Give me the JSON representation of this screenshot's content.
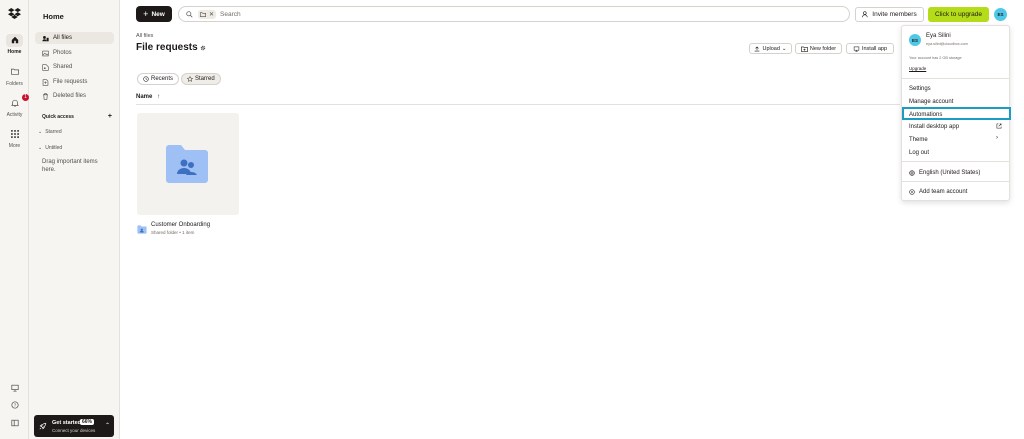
{
  "rail": {
    "items": [
      {
        "label": "Home"
      },
      {
        "label": "Folders"
      },
      {
        "label": "Activity",
        "badge": "1"
      },
      {
        "label": "More"
      }
    ]
  },
  "sidebar": {
    "title": "Home",
    "items": [
      {
        "label": "All files",
        "icon": "all-files-icon"
      },
      {
        "label": "Photos",
        "icon": "photos-icon"
      },
      {
        "label": "Shared",
        "icon": "shared-icon"
      },
      {
        "label": "File requests",
        "icon": "file-requests-icon"
      },
      {
        "label": "Deleted files",
        "icon": "trash-icon"
      }
    ],
    "quick_access": "Quick access",
    "starred": "Starred",
    "untitled": "Untitled",
    "drag_note": "Drag important items here.",
    "get_started": {
      "title": "Get started",
      "percent": "66%",
      "subtitle": "Connect your devices"
    }
  },
  "toolbar": {
    "new_label": "New",
    "search_placeholder": "Search",
    "invite_label": "Invite members",
    "upgrade_label": "Click to upgrade",
    "avatar_initials": "ES"
  },
  "main": {
    "breadcrumb": "All files",
    "title": "File requests",
    "actions": [
      {
        "label": "Upload",
        "icon": "upload-icon"
      },
      {
        "label": "New folder",
        "icon": "new-folder-icon"
      },
      {
        "label": "Install app",
        "icon": "monitor-icon"
      }
    ],
    "filters": [
      {
        "label": "Recents"
      },
      {
        "label": "Starred"
      }
    ],
    "column_name": "Name",
    "files": [
      {
        "name": "Customer Onboarding",
        "meta": "Shared folder • 1 item"
      }
    ]
  },
  "account_menu": {
    "initials": "ES",
    "name": "Eya Silini",
    "email": "eya.silini@cloudbox.com",
    "storage": "Your account has 2 GB storage",
    "upgrade": "Upgrade",
    "items": [
      {
        "label": "Settings"
      },
      {
        "label": "Manage account"
      },
      {
        "label": "Automations"
      },
      {
        "label": "Install desktop app"
      },
      {
        "label": "Theme"
      },
      {
        "label": "Log out"
      }
    ],
    "language": "English (United States)",
    "add_team": "Add team account"
  },
  "colors": {
    "accent_upgrade": "#b4dc19",
    "avatar": "#4fc8e8",
    "highlight": "#1c9bc3",
    "folder": "#9ec0f4",
    "dark": "#1e1919"
  }
}
